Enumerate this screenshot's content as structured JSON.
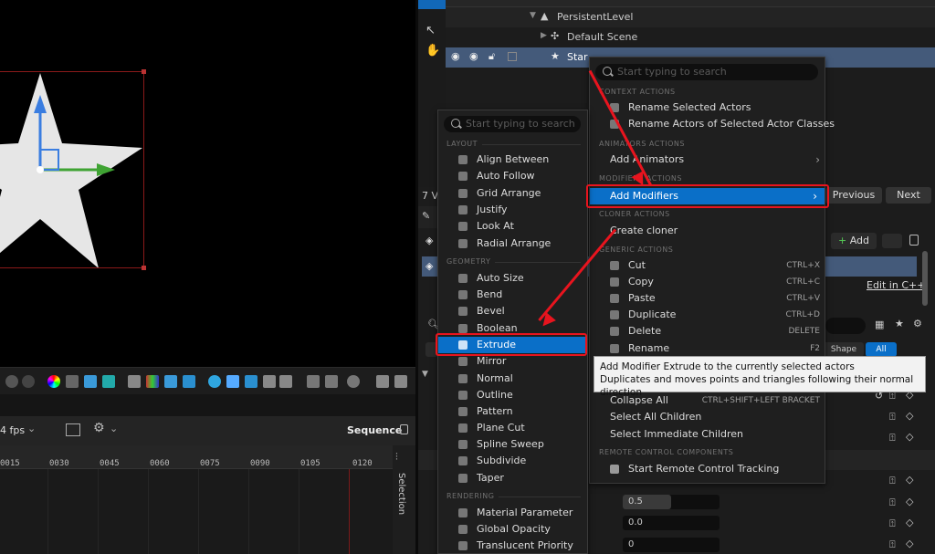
{
  "outliner": {
    "persistent_level": "PersistentLevel",
    "default_scene": "Default Scene",
    "star": "Star"
  },
  "sequencer": {
    "fps": "4 fps",
    "title": "Sequence",
    "side_label": "Selection",
    "ticks": [
      "0015",
      "0030",
      "0045",
      "0060",
      "0075",
      "0090",
      "0105",
      "0120"
    ]
  },
  "details": {
    "index_label": "7 V",
    "previous": "Previous",
    "next": "Next",
    "add_button": "Add",
    "edit_cpp": "Edit in C++",
    "shape_tab": "Shape",
    "all_tab": "All",
    "values": [
      "0.5",
      "0.0",
      "0"
    ],
    "fill_fraction": 0.5
  },
  "context_menu": {
    "search_placeholder": "Start typing to search",
    "sections": {
      "context": "CONTEXT ACTIONS",
      "animators": "ANIMATORS ACTIONS",
      "modifiers": "MODIFIERS ACTIONS",
      "cloner": "CLONER ACTIONS",
      "generic": "GENERIC ACTIONS",
      "remote": "REMOTE CONTROL COMPONENTS"
    },
    "items": {
      "rename_selected": "Rename Selected Actors",
      "rename_classes": "Rename Actors of Selected Actor Classes",
      "add_animators": "Add Animators",
      "add_modifiers": "Add Modifiers",
      "create_cloner": "Create cloner",
      "cut": "Cut",
      "copy": "Copy",
      "paste": "Paste",
      "duplicate": "Duplicate",
      "delete": "Delete",
      "rename": "Rename",
      "collapse_all": "Collapse All",
      "select_all_children": "Select All Children",
      "select_immediate_children": "Select Immediate Children",
      "start_remote": "Start Remote Control Tracking"
    },
    "shortcuts": {
      "cut": "CTRL+X",
      "copy": "CTRL+C",
      "paste": "CTRL+V",
      "duplicate": "CTRL+D",
      "delete": "DELETE",
      "rename": "F2",
      "collapse_all": "CTRL+SHIFT+LEFT BRACKET"
    }
  },
  "modifiers_menu": {
    "search_placeholder": "Start typing to search",
    "sections": {
      "layout": "LAYOUT",
      "geometry": "GEOMETRY",
      "rendering": "RENDERING"
    },
    "layout": [
      "Align Between",
      "Auto Follow",
      "Grid Arrange",
      "Justify",
      "Look At",
      "Radial Arrange"
    ],
    "geometry": [
      "Auto Size",
      "Bend",
      "Bevel",
      "Boolean",
      "Extrude",
      "Mirror",
      "Normal",
      "Outline",
      "Pattern",
      "Plane Cut",
      "Spline Sweep",
      "Subdivide",
      "Taper"
    ],
    "rendering": [
      "Material Parameter",
      "Global Opacity",
      "Translucent Priority"
    ]
  },
  "tooltip": {
    "line1": "Add Modifier Extrude to the currently selected actors",
    "line2": "Duplicates and moves points and triangles following their normal direction"
  },
  "colors": {
    "highlight": "#0a6fc8",
    "annotation": "#e8141e",
    "gizmo_up": "#3a7de0",
    "gizmo_right": "#3fa333"
  }
}
